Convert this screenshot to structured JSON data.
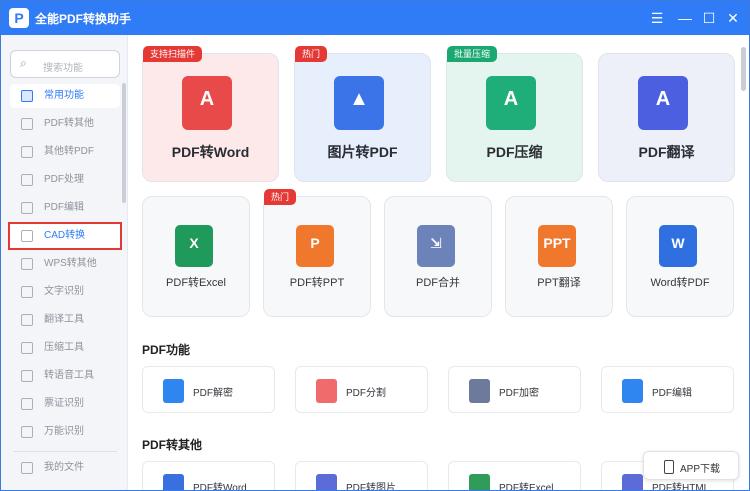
{
  "app": {
    "title": "全能PDF转换助手",
    "logo": "P"
  },
  "titlebar_icons": [
    "menu-icon",
    "minimize-icon",
    "maximize-icon",
    "close-icon"
  ],
  "sidebar": {
    "search_placeholder": "搜索功能",
    "items": [
      {
        "label": "常用功能",
        "icon": "home-icon"
      },
      {
        "label": "PDF转其他",
        "icon": "pdf-icon"
      },
      {
        "label": "其他转PDF",
        "icon": "doc-icon"
      },
      {
        "label": "PDF处理",
        "icon": "pdf-process-icon"
      },
      {
        "label": "PDF编辑",
        "icon": "pdf-edit-icon"
      },
      {
        "label": "CAD转换",
        "icon": "cad-icon"
      },
      {
        "label": "WPS转其他",
        "icon": "wps-icon"
      },
      {
        "label": "文字识别",
        "icon": "ocr-icon"
      },
      {
        "label": "翻译工具",
        "icon": "translate-icon"
      },
      {
        "label": "压缩工具",
        "icon": "compress-icon"
      },
      {
        "label": "转语音工具",
        "icon": "audio-icon"
      },
      {
        "label": "票证识别",
        "icon": "ticket-icon"
      },
      {
        "label": "万能识别",
        "icon": "scan-icon"
      }
    ],
    "my_files": "我的文件"
  },
  "feature_cards": [
    {
      "label": "PDF转Word",
      "tag": "支持扫描件",
      "tag_color": "#e53935",
      "bg": "#fde9e9",
      "icon_color": "#e84a4a",
      "glyph": "A"
    },
    {
      "label": "图片转PDF",
      "tag": "热门",
      "tag_color": "#e53935",
      "bg": "#e7effc",
      "icon_color": "#3b74e8",
      "glyph": "▲"
    },
    {
      "label": "PDF压缩",
      "tag": "批量压缩",
      "tag_color": "#1aa870",
      "bg": "#e3f5ee",
      "icon_color": "#1fae7a",
      "glyph": "A"
    },
    {
      "label": "PDF翻译",
      "tag": "",
      "tag_color": "#2f7cf6",
      "bg": "#edf0f8",
      "icon_color": "#4c5fe0",
      "glyph": "A"
    }
  ],
  "tool_cards": [
    {
      "label": "PDF转Excel",
      "tag": "",
      "icon_color": "#1f9a5a",
      "glyph": "X"
    },
    {
      "label": "PDF转PPT",
      "tag": "热门",
      "icon_color": "#f0782c",
      "glyph": "P"
    },
    {
      "label": "PDF合并",
      "tag": "",
      "icon_color": "#6b83b8",
      "glyph": "⇲"
    },
    {
      "label": "PPT翻译",
      "tag": "",
      "icon_color": "#f0782c",
      "glyph": "PPT"
    },
    {
      "label": "Word转PDF",
      "tag": "",
      "icon_color": "#2f6fe0",
      "glyph": "W"
    }
  ],
  "sections": {
    "pdf_functions": "PDF功能",
    "pdf_to_other": "PDF转其他"
  },
  "pdf_functions": [
    {
      "label": "PDF解密",
      "icon_color": "#2f86f0"
    },
    {
      "label": "PDF分割",
      "icon_color": "#f06b6b"
    },
    {
      "label": "PDF加密",
      "icon_color": "#6d7a9c"
    },
    {
      "label": "PDF编辑",
      "icon_color": "#2f86f0"
    }
  ],
  "pdf_to_other": [
    {
      "label": "PDF转Word",
      "icon_color": "#3a6fe0"
    },
    {
      "label": "PDF转图片",
      "icon_color": "#5b6cd8"
    },
    {
      "label": "PDF转Excel",
      "icon_color": "#2f9c5a"
    },
    {
      "label": "PDF转HTML",
      "icon_color": "#5b6cd8"
    }
  ],
  "app_download": "APP下载"
}
